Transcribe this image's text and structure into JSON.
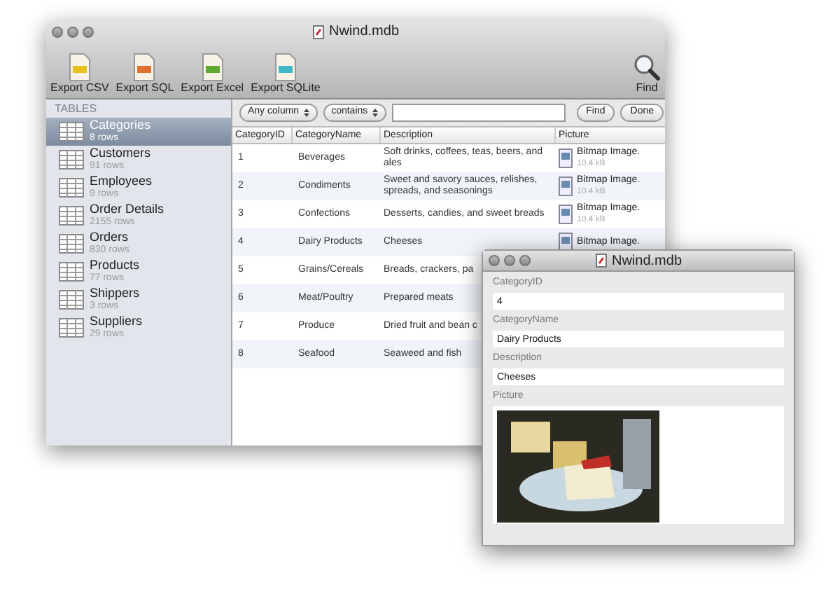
{
  "main_window": {
    "title": "Nwind.mdb",
    "toolbar": [
      {
        "label": "Export CSV",
        "color": "#e8c020"
      },
      {
        "label": "Export SQL",
        "color": "#e07030"
      },
      {
        "label": "Export Excel",
        "color": "#60a830"
      },
      {
        "label": "Export SQLite",
        "color": "#40b8c8"
      }
    ],
    "find_button": "Find",
    "sidebar": {
      "heading": "TABLES",
      "items": [
        {
          "name": "Categories",
          "rows": "8 rows",
          "selected": true
        },
        {
          "name": "Customers",
          "rows": "91 rows",
          "selected": false
        },
        {
          "name": "Employees",
          "rows": "9 rows",
          "selected": false
        },
        {
          "name": "Order Details",
          "rows": "2155 rows",
          "selected": false
        },
        {
          "name": "Orders",
          "rows": "830 rows",
          "selected": false
        },
        {
          "name": "Products",
          "rows": "77 rows",
          "selected": false
        },
        {
          "name": "Shippers",
          "rows": "3 rows",
          "selected": false
        },
        {
          "name": "Suppliers",
          "rows": "29 rows",
          "selected": false
        }
      ]
    },
    "search": {
      "column": "Any column",
      "operator": "contains",
      "find": "Find",
      "done": "Done"
    },
    "table": {
      "columns": [
        "CategoryID",
        "CategoryName",
        "Description",
        "Picture"
      ],
      "rows": [
        {
          "id": "1",
          "name": "Beverages",
          "description": "Soft drinks, coffees, teas, beers, and ales",
          "picture": "Bitmap Image.",
          "size": "10.4 kB"
        },
        {
          "id": "2",
          "name": "Condiments",
          "description": "Sweet and savory sauces, relishes, spreads, and seasonings",
          "picture": "Bitmap Image.",
          "size": "10.4 kB"
        },
        {
          "id": "3",
          "name": "Confections",
          "description": "Desserts, candies, and sweet breads",
          "picture": "Bitmap Image.",
          "size": "10.4 kB"
        },
        {
          "id": "4",
          "name": "Dairy Products",
          "description": "Cheeses",
          "picture": "Bitmap Image."
        },
        {
          "id": "5",
          "name": "Grains/Cereals",
          "description": "Breads, crackers, pa"
        },
        {
          "id": "6",
          "name": "Meat/Poultry",
          "description": "Prepared meats"
        },
        {
          "id": "7",
          "name": "Produce",
          "description": "Dried fruit and bean c"
        },
        {
          "id": "8",
          "name": "Seafood",
          "description": "Seaweed and fish"
        }
      ]
    }
  },
  "record_window": {
    "title": "Nwind.mdb",
    "fields": [
      {
        "label": "CategoryID",
        "value": "4",
        "kind": "text"
      },
      {
        "label": "CategoryName",
        "value": "Dairy Products",
        "kind": "text"
      },
      {
        "label": "Description",
        "value": "Cheeses",
        "kind": "text"
      },
      {
        "label": "Picture",
        "kind": "image"
      }
    ]
  }
}
